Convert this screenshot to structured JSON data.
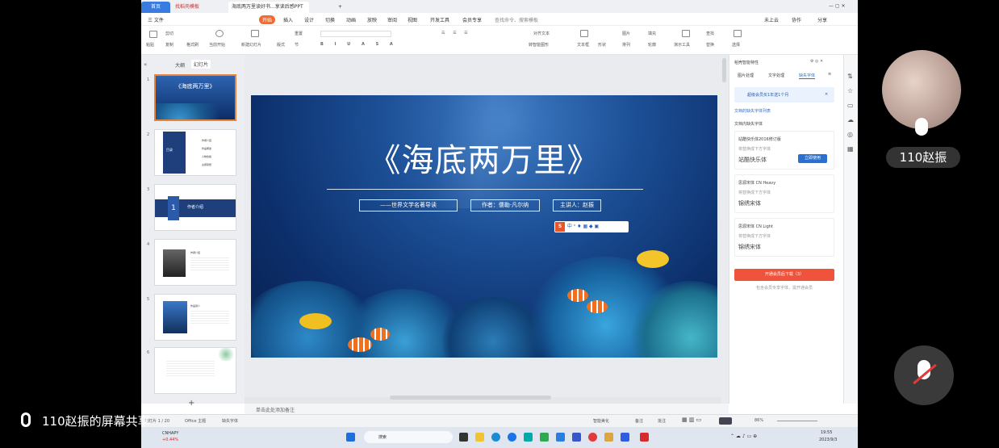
{
  "tabs": {
    "home": "首页",
    "tpl": "找稻壳模板",
    "doc": "海底两万里读好书...享读后感PPT",
    "add": "+"
  },
  "menu": {
    "file": "三 文件",
    "start": "开始",
    "insert": "插入",
    "design": "设计",
    "transition": "切换",
    "animation": "动画",
    "slideshow": "放映",
    "review": "审阅",
    "view": "视图",
    "dev": "开发工具",
    "member": "会员专享",
    "search": "查找命令、搜索模板",
    "cloud": "未上云",
    "collab": "协作",
    "share": "分享"
  },
  "ribbon": {
    "paste": "粘贴",
    "cut": "剪切",
    "copy": "复制",
    "format": "格式刷",
    "from_current": "当前开始",
    "new_slide": "新建幻灯片",
    "layout": "版式",
    "section": "节",
    "reset": "重置",
    "textbox": "文本框",
    "shape": "形状",
    "arrange": "排列",
    "picture": "图片",
    "fill": "填充",
    "outline": "轮廓",
    "present": "演示工具",
    "find": "查找",
    "replace": "替换",
    "select": "选择",
    "align_text": "对齐文本",
    "smartart": "转智能图形"
  },
  "left": {
    "outline": "大纲",
    "slides": "幻灯片",
    "nums": [
      "1",
      "2",
      "3",
      "4",
      "5",
      "6"
    ],
    "add": "+"
  },
  "thumbs": {
    "t1_title": "《海底两万里》",
    "t2_items": [
      "作者介绍",
      "作品概述",
      "人物性格",
      "主题思想"
    ],
    "t2_label": "目录",
    "t3_num": "1",
    "t3_title": "作者介绍",
    "t4_title": "作者介绍",
    "t5_title": "作品简介"
  },
  "slide": {
    "title": "《海底两万里》",
    "subtitle": "——世界文学名著导读",
    "author": "作者：儒勒·凡尔纳",
    "speaker": "主讲人：赵振",
    "ime": "中"
  },
  "rpanel": {
    "header": "稻壳智能特性",
    "tab1": "图片处理",
    "tab2": "文字处理",
    "tab3": "缺失字体",
    "promo": "超级会员买1年送1个月",
    "nofonts": "文档的缺失字体列表",
    "section": "文档内缺失字体",
    "fonts": [
      {
        "name": "站酷快乐体2016修订版",
        "hint": "将替换成下方字体",
        "preview": "站酷快乐体",
        "btn": "立即使用"
      },
      {
        "name": "思源宋体 CN Heavy",
        "hint": "将替换成下方字体",
        "preview": "锦绣宋体"
      },
      {
        "name": "思源宋体 CN Light",
        "hint": "将替换成下方字体",
        "preview": "锦绣宋体"
      }
    ],
    "download": "开通会员后下载（3）",
    "foot": "包含会员专享字体，需开通会员"
  },
  "canvas": {
    "notes": "单击此处添加备注"
  },
  "status": {
    "slide": "幻灯片 1 / 20",
    "theme": "Office 主题",
    "missing": "缺失字体",
    "smart": "智能美化",
    "notes": "备注",
    "comment": "批注",
    "zoom": "86%"
  },
  "taskbar": {
    "stock": "CNHAPY",
    "stock_change": "+0.44%",
    "search": "搜索",
    "time": "19:55",
    "date": "2023/9/3"
  },
  "overlay": {
    "share": "110赵振的屏幕共享",
    "name": "110赵振"
  }
}
